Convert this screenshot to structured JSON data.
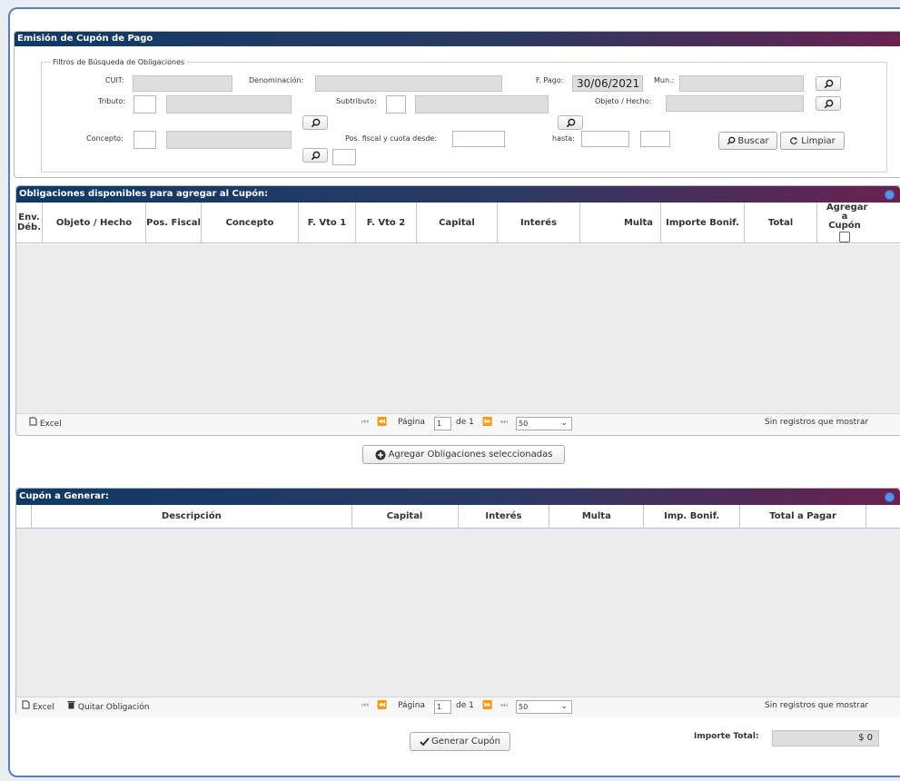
{
  "header": {
    "title": "Emisión de Cupón de Pago"
  },
  "filters": {
    "legend": "Filtros de Búsqueda de Obligaciones",
    "cuit_label": "CUIT:",
    "denominacion_label": "Denominación:",
    "fpago_label": "F. Pago:",
    "fpago_value": "30/06/2021",
    "mun_label": "Mun.:",
    "tributo_label": "Tributo:",
    "subtributo_label": "Subtributo:",
    "objeto_label": "Objeto / Hecho:",
    "concepto_label": "Concepto:",
    "pos_label": "Pos. fiscal y cuota desde:",
    "hasta_label": "hasta:",
    "buscar_label": "Buscar",
    "limpiar_label": "Limpiar"
  },
  "obligaciones": {
    "title": "Obligaciones disponibles para agregar al Cupón:",
    "columns": [
      "Env. Déb.",
      "Objeto / Hecho",
      "Pos. Fiscal",
      "Concepto",
      "F. Vto 1",
      "F. Vto 2",
      "Capital",
      "Interés",
      "Multa",
      "Importe Bonif.",
      "Total",
      "Agregar a Cupón"
    ],
    "excel_label": "Excel",
    "pager": {
      "page_label": "Página",
      "page_value": "1",
      "of_label": "de 1",
      "size_value": "50",
      "empty_text": "Sin registros que mostrar"
    },
    "add_button": "Agregar Obligaciones seleccionadas"
  },
  "cupon": {
    "title": "Cupón a Generar:",
    "columns": [
      "Descripción",
      "Capital",
      "Interés",
      "Multa",
      "Imp. Bonif.",
      "Total a Pagar"
    ],
    "excel_label": "Excel",
    "remove_label": "Quitar Obligación",
    "pager": {
      "page_label": "Página",
      "page_value": "1",
      "of_label": "de 1",
      "size_value": "50",
      "empty_text": "Sin registros que mostrar"
    },
    "generate_button": "Generar Cupón",
    "total_label": "Importe Total:",
    "total_value": "$ 0"
  },
  "colors": {
    "bar_start": "#0f3a66",
    "bar_end": "#6a2150",
    "accent": "#5b8fe0"
  },
  "icons": [
    "search-icon",
    "refresh-icon",
    "plus-circle-icon",
    "check-icon",
    "excel-icon",
    "trash-icon",
    "collapse-icon",
    "page-first-icon",
    "page-prev-icon",
    "page-next-icon",
    "page-last-icon",
    "chevron-down-icon"
  ]
}
